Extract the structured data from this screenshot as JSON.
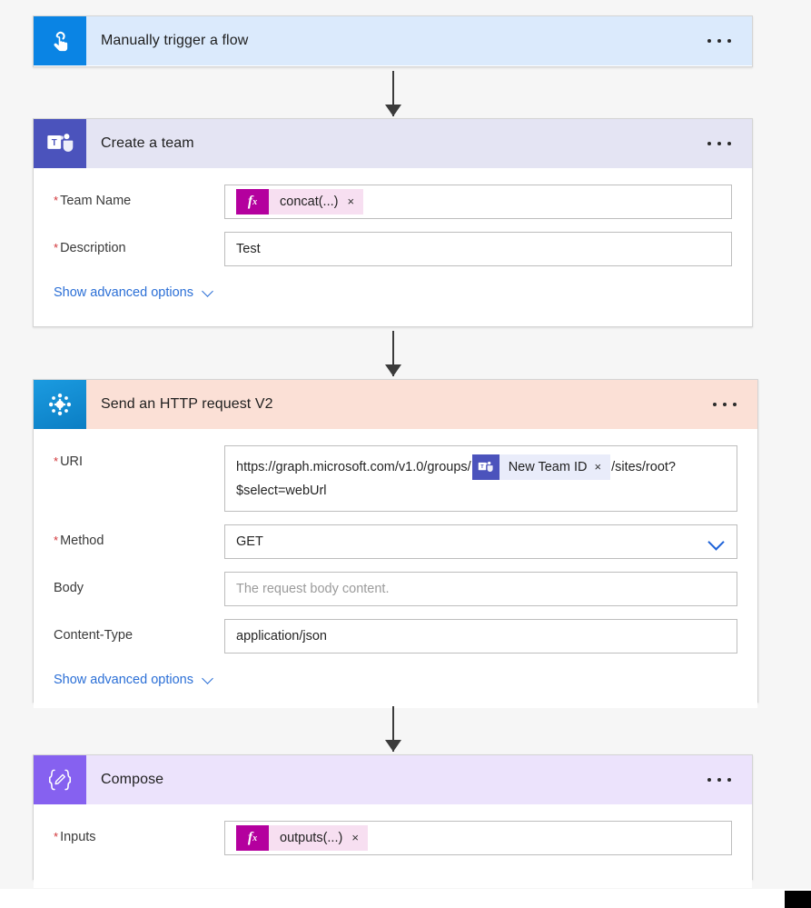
{
  "flow": {
    "steps": [
      {
        "id": "trigger",
        "title": "Manually trigger a flow",
        "icon": "touch-hand-icon",
        "header_color": "#dbeafc",
        "icon_color": "#0a84e4",
        "menu_label": "..."
      },
      {
        "id": "create-a-team",
        "title": "Create a team",
        "icon": "microsoft-teams-icon",
        "header_color": "#e4e4f3",
        "icon_color": "#4b53bc",
        "menu_label": "...",
        "fields": [
          {
            "label": "Team Name",
            "required": true,
            "type": "expression-token",
            "token": {
              "kind": "fx",
              "text": "concat(...)",
              "remove": "×"
            }
          },
          {
            "label": "Description",
            "required": true,
            "type": "text",
            "value": "Test"
          }
        ],
        "advanced_link": "Show advanced options"
      },
      {
        "id": "send-an-http-request-v2",
        "title": "Send an HTTP request V2",
        "icon": "office365-groups-burst-icon",
        "header_color": "#fbe0d6",
        "icon_color": "#1b9be0",
        "menu_label": "...",
        "fields": [
          {
            "label": "URI",
            "required": true,
            "type": "rich-text",
            "prefix": "https://graph.microsoft.com/v1.0/groups/",
            "token": {
              "kind": "dynamic",
              "icon": "microsoft-teams-icon",
              "text": "New Team ID",
              "remove": "×"
            },
            "suffix": "/sites/root?$select=webUrl"
          },
          {
            "label": "Method",
            "required": true,
            "type": "select",
            "value": "GET"
          },
          {
            "label": "Body",
            "required": false,
            "type": "text",
            "value": "",
            "placeholder": "The request body content."
          },
          {
            "label": "Content-Type",
            "required": false,
            "type": "text",
            "value": "application/json"
          }
        ],
        "advanced_link": "Show advanced options"
      },
      {
        "id": "compose",
        "title": "Compose",
        "icon": "compose-braces-icon",
        "header_color": "#ece3fc",
        "icon_color": "#8661f0",
        "menu_label": "...",
        "fields": [
          {
            "label": "Inputs",
            "required": true,
            "type": "expression-token",
            "token": {
              "kind": "fx",
              "text": "outputs(...)",
              "remove": "×"
            }
          }
        ]
      }
    ]
  },
  "colors": {
    "canvas_background": "#f6f6f6",
    "accent_link": "#2b6fd6",
    "required_marker": "#d13438",
    "fx_badge": "#b4009e",
    "fx_body": "#f7dff1",
    "dynamic_token_body": "#e9ecfa",
    "connector": "#3b3b3b"
  }
}
